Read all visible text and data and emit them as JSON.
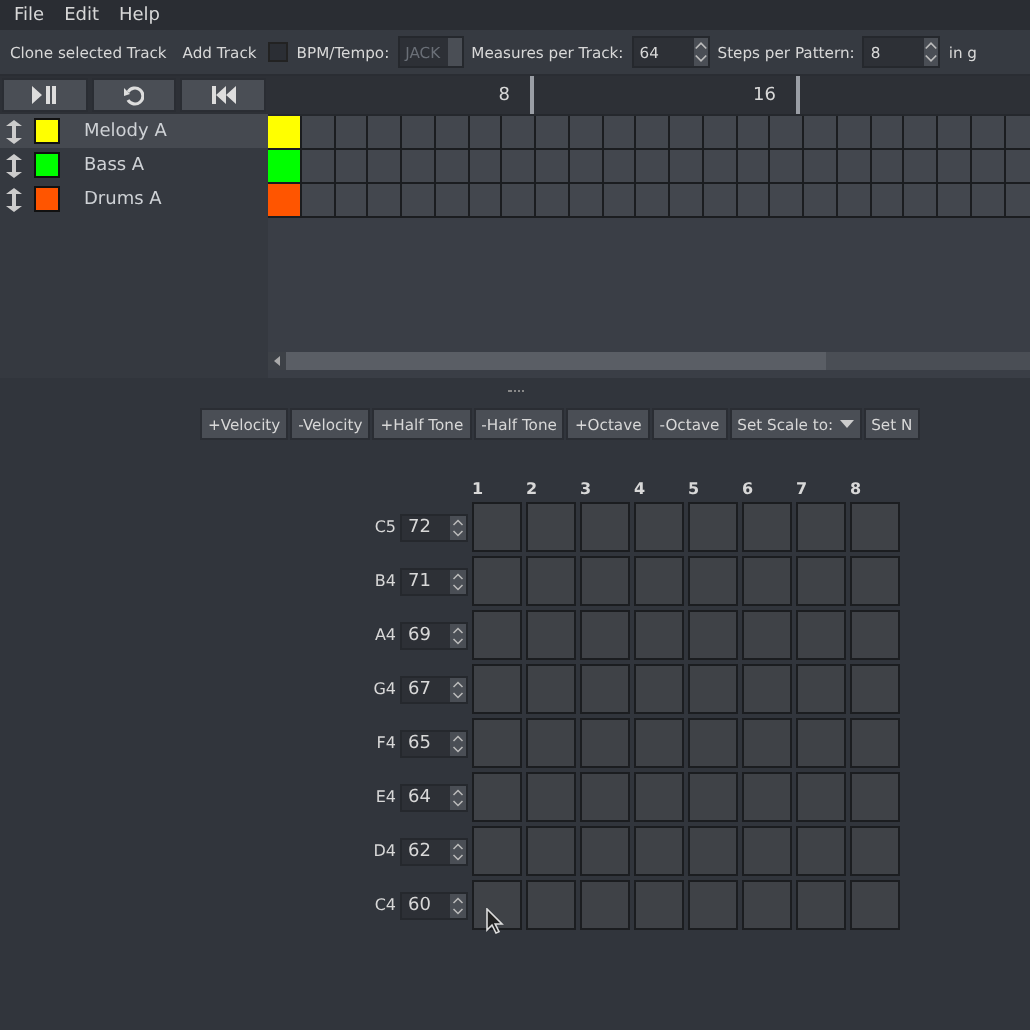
{
  "menu": [
    "File",
    "Edit",
    "Help"
  ],
  "toolbar": {
    "clone": "Clone selected Track",
    "add": "Add Track",
    "bpm": {
      "label": "BPM/Tempo:",
      "checked": false,
      "value": "JACK",
      "disabled": true
    },
    "measures": {
      "label": "Measures per Track:",
      "value": "64"
    },
    "steps": {
      "label": "Steps per Pattern:",
      "value": "8"
    },
    "cut_label": "in g"
  },
  "ruler": [
    "8",
    "16"
  ],
  "tracks": [
    {
      "name": "Melody A",
      "color": "#ffff00",
      "selected": true
    },
    {
      "name": "Bass A",
      "color": "#00ff00",
      "selected": false
    },
    {
      "name": "Drums A",
      "color": "#ff5500",
      "selected": false
    }
  ],
  "pattern_buttons": [
    "+Velocity",
    "-Velocity",
    "+Half Tone",
    "-Half Tone",
    "+Octave",
    "-Octave"
  ],
  "scale_dropdown": "Set Scale to:",
  "cut_button": "Set N",
  "columns": [
    "1",
    "2",
    "3",
    "4",
    "5",
    "6",
    "7",
    "8"
  ],
  "notes": [
    {
      "name": "C5",
      "value": "72"
    },
    {
      "name": "B4",
      "value": "71"
    },
    {
      "name": "A4",
      "value": "69"
    },
    {
      "name": "G4",
      "value": "67"
    },
    {
      "name": "F4",
      "value": "65"
    },
    {
      "name": "E4",
      "value": "64"
    },
    {
      "name": "D4",
      "value": "62"
    },
    {
      "name": "C4",
      "value": "60"
    }
  ]
}
